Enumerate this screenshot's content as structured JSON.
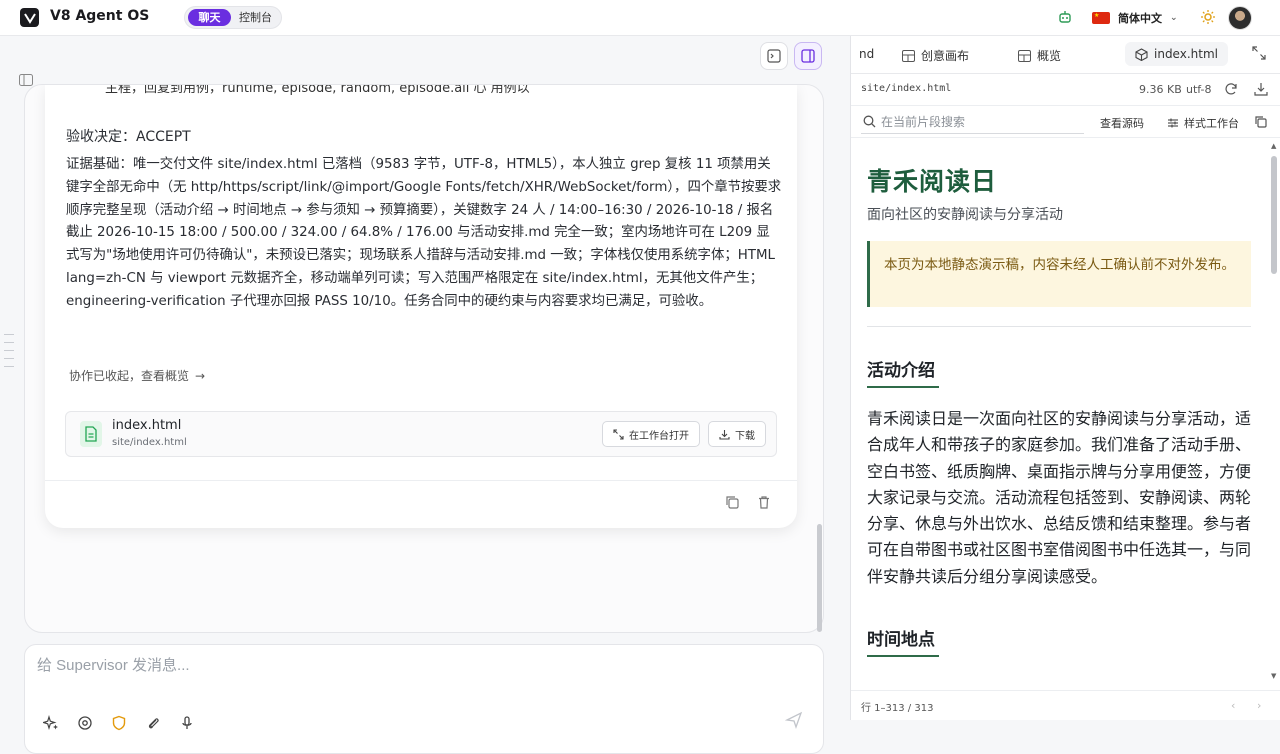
{
  "app": {
    "title": "V8 Agent OS",
    "mode_chat": "聊天",
    "mode_console": "控制台",
    "language": "简体中文"
  },
  "chat": {
    "cut_line": "主程，回复到用例，runtime, episode, random, episode.all 心 用例以",
    "decision": "验收决定：ACCEPT",
    "evidence": "证据基础：唯一交付文件 site/index.html 已落档（9583 字节，UTF-8，HTML5），本人独立 grep 复核 11 项禁用关键字全部无命中（无 http/https/script/link/@import/Google Fonts/fetch/XHR/WebSocket/form），四个章节按要求顺序完整呈现（活动介绍 → 时间地点 → 参与须知 → 预算摘要），关键数字 24 人 / 14:00–16:30 / 2026-10-18 / 报名截止 2026-10-15 18:00 / 500.00 / 324.00 / 64.8% / 176.00 与活动安排.md 完全一致；室内场地许可在 L209 显式写为\"场地使用许可仍待确认\"，未预设已落实；现场联系人措辞与活动安排.md 一致；字体栈仅使用系统字体；HTML lang=zh-CN 与 viewport 元数据齐全，移动端单列可读；写入范围严格限定在 site/index.html，无其他文件产生；engineering-verification 子代理亦回报 PASS 10/10。任务合同中的硬约束与内容要求均已满足，可验收。",
    "collapse_link": "协作已收起，查看概览",
    "collapse_arrow": "→",
    "file": {
      "name": "index.html",
      "path": "site/index.html",
      "open_label": "在工作台打开",
      "download_label": "下载"
    },
    "composer_placeholder": "给 Supervisor 发消息..."
  },
  "panel": {
    "tabs": [
      {
        "label": "nd"
      },
      {
        "label": "创意画布"
      },
      {
        "label": "概览"
      },
      {
        "label": "index.html"
      }
    ],
    "file_path": "site/index.html",
    "file_size": "9.36 KB",
    "encoding": "utf-8",
    "search_placeholder": "在当前片段搜索",
    "view_source": "查看源码",
    "style_workbench": "样式工作台",
    "status": "行 1–313 / 313"
  },
  "preview": {
    "title": "青禾阅读日",
    "subtitle": "面向社区的安静阅读与分享活动",
    "note": "本页为本地静态演示稿，内容未经人工确认前不对外发布。",
    "section1": "活动介绍",
    "body1": "青禾阅读日是一次面向社区的安静阅读与分享活动，适合成年人和带孩子的家庭参加。我们准备了活动手册、空白书签、纸质胸牌、桌面指示牌与分享用便签，方便大家记录与交流。活动流程包括签到、安静阅读、两轮分享、休息与外出饮水、总结反馈和结束整理。参与者可在自带图书或社区图书室借阅图书中任选其一，与同伴安静共读后分组分享阅读感受。",
    "section2": "时间地点"
  },
  "colors": {
    "accent": "#6a2ee0",
    "heading_green": "#1e5d3d",
    "note_bg": "#fdf6df"
  }
}
